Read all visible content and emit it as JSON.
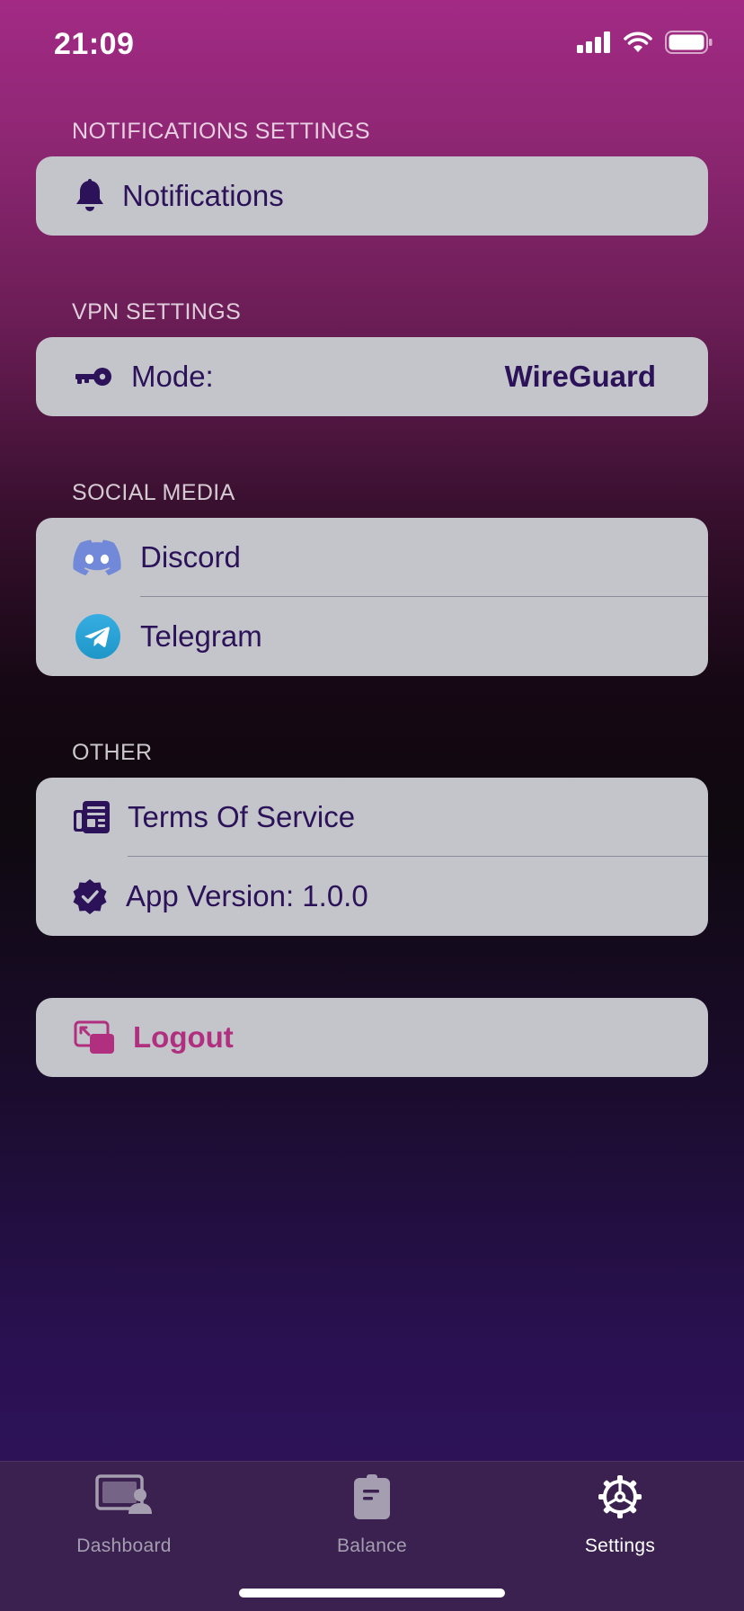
{
  "status_bar": {
    "time": "21:09"
  },
  "sections": {
    "notifications": {
      "title": "NOTIFICATIONS SETTINGS",
      "items": [
        {
          "label": "Notifications",
          "icon": "bell-icon"
        }
      ]
    },
    "vpn": {
      "title": "VPN SETTINGS",
      "items": [
        {
          "label": "Mode:",
          "value": "WireGuard",
          "icon": "key-icon"
        }
      ]
    },
    "social": {
      "title": "SOCIAL MEDIA",
      "items": [
        {
          "label": "Discord",
          "icon": "discord-icon"
        },
        {
          "label": "Telegram",
          "icon": "telegram-icon"
        }
      ]
    },
    "other": {
      "title": "OTHER",
      "items": [
        {
          "label": "Terms Of Service",
          "icon": "newspaper-icon"
        },
        {
          "label": "App Version: 1.0.0",
          "icon": "verified-badge-icon"
        }
      ]
    }
  },
  "logout": {
    "label": "Logout",
    "icon": "logout-icon",
    "color": "#b0307f"
  },
  "tabbar": {
    "tabs": [
      {
        "label": "Dashboard",
        "icon": "dashboard-icon",
        "active": false
      },
      {
        "label": "Balance",
        "icon": "clipboard-icon",
        "active": false
      },
      {
        "label": "Settings",
        "icon": "settings-gear-icon",
        "active": true
      }
    ]
  },
  "colors": {
    "text_primary": "#2b1259",
    "row_bg": "#c4c5ca",
    "accent": "#b0307f",
    "discord": "#7289da",
    "telegram": "#2aa3e0"
  }
}
